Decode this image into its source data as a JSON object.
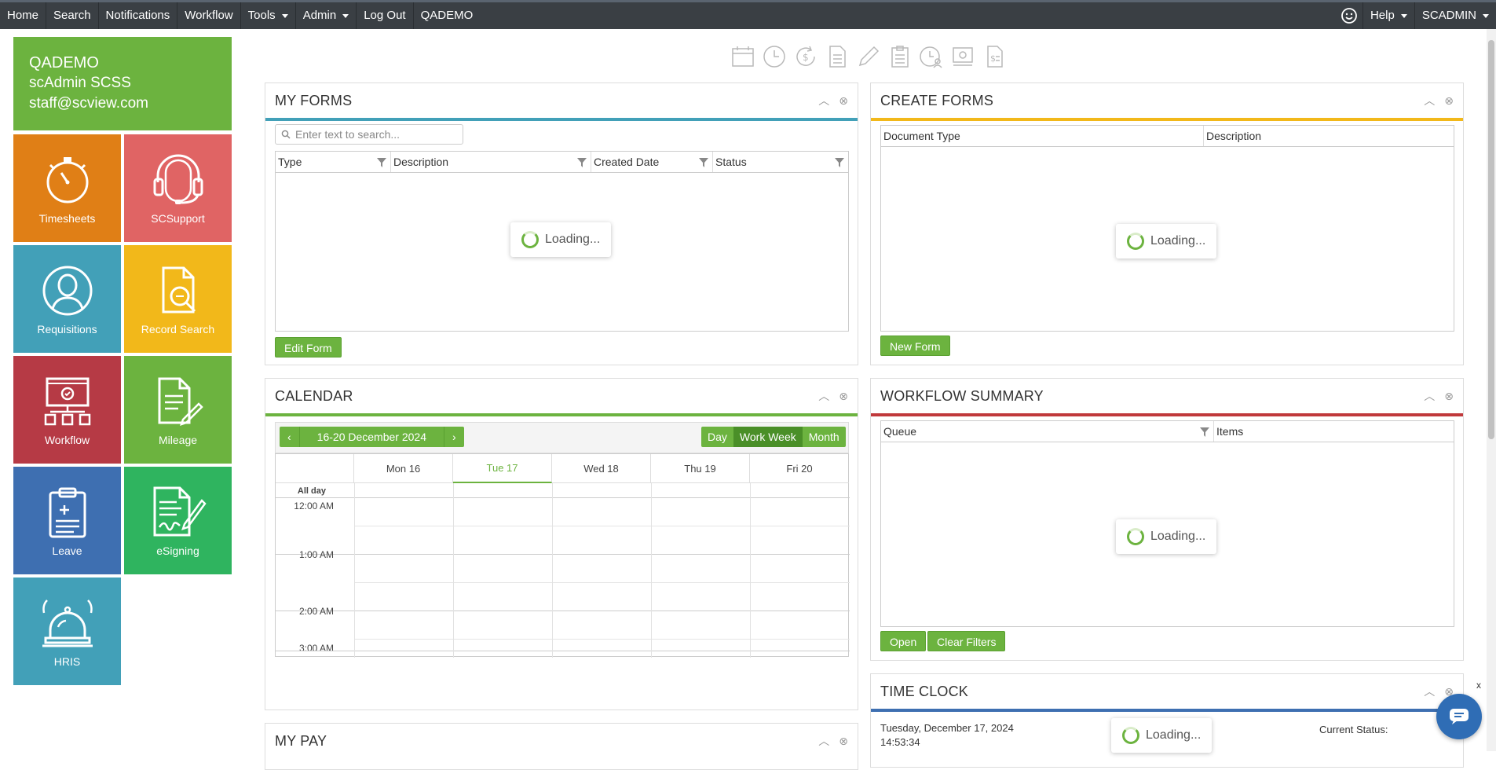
{
  "nav": {
    "items": [
      {
        "label": "Home"
      },
      {
        "label": "Search"
      },
      {
        "label": "Notifications"
      },
      {
        "label": "Workflow"
      },
      {
        "label": "Tools"
      },
      {
        "label": "Admin"
      },
      {
        "label": "Log Out"
      },
      {
        "label": "QADEMO"
      }
    ],
    "help": "Help",
    "user": "SCADMIN"
  },
  "user_card": {
    "org": "QADEMO",
    "name": "scAdmin SCSS",
    "email": "staff@scview.com"
  },
  "tiles": [
    {
      "label": "Timesheets",
      "color": "#e07f16",
      "icon": "stopwatch-icon"
    },
    {
      "label": "SCSupport",
      "color": "#e06464",
      "icon": "headset-icon"
    },
    {
      "label": "Requisitions",
      "color": "#42a0b8",
      "icon": "person-icon"
    },
    {
      "label": "Record Search",
      "color": "#f2b81a",
      "icon": "document-search-icon"
    },
    {
      "label": "Workflow",
      "color": "#b63a45",
      "icon": "workflow-icon"
    },
    {
      "label": "Mileage",
      "color": "#6cb33f",
      "icon": "document-pencil-icon"
    },
    {
      "label": "Leave",
      "color": "#3e6fb1",
      "icon": "clipboard-icon"
    },
    {
      "label": "eSigning",
      "color": "#2fb45f",
      "icon": "signature-icon"
    },
    {
      "label": "HRIS",
      "color": "#42a0b8",
      "icon": "bell-icon"
    }
  ],
  "panels": {
    "my_forms": {
      "title": "MY FORMS",
      "search_placeholder": "Enter text to search...",
      "columns": [
        "Type",
        "Description",
        "Created Date",
        "Status"
      ],
      "loading": "Loading...",
      "button": "Edit Form",
      "accent": "#42a0b8"
    },
    "create_forms": {
      "title": "CREATE FORMS",
      "columns": [
        "Document Type",
        "Description"
      ],
      "loading": "Loading...",
      "button": "New Form",
      "accent": "#f2b81a"
    },
    "calendar": {
      "title": "CALENDAR",
      "range": "16-20 December 2024",
      "views": [
        "Day",
        "Work Week",
        "Month"
      ],
      "active_view": "Work Week",
      "days": [
        "Mon 16",
        "Tue 17",
        "Wed 18",
        "Thu 19",
        "Fri 20"
      ],
      "today": "Tue 17",
      "all_day": "All day",
      "times": [
        "12:00 AM",
        "1:00 AM",
        "2:00 AM",
        "3:00 AM"
      ],
      "accent": "#6cb33f"
    },
    "workflow_summary": {
      "title": "WORKFLOW SUMMARY",
      "columns": [
        "Queue",
        "Items"
      ],
      "loading": "Loading...",
      "buttons": [
        "Open",
        "Clear Filters"
      ],
      "accent": "#c0393b"
    },
    "time_clock": {
      "title": "TIME CLOCK",
      "date": "Tuesday, December 17, 2024",
      "time": "14:53:34",
      "loading": "Loading...",
      "status_label": "Current Status:",
      "accent": "#3e6fb1"
    },
    "my_pay": {
      "title": "MY PAY"
    }
  }
}
